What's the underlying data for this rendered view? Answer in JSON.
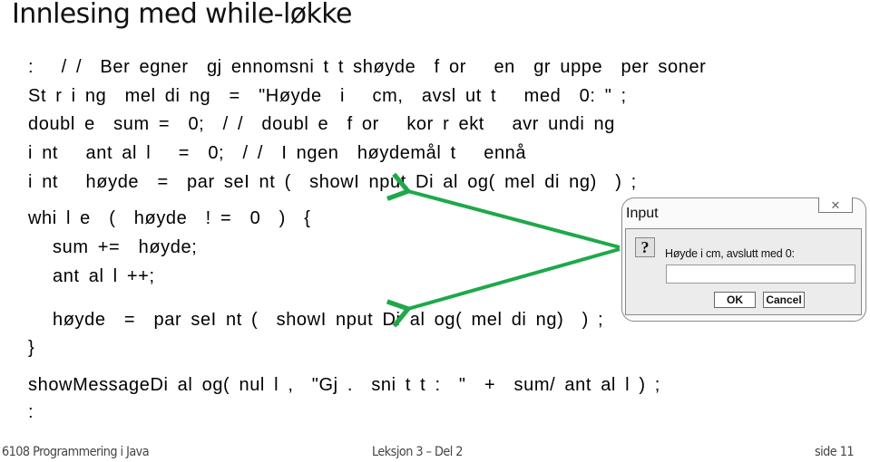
{
  "slide": {
    "title": "Innlesing med while-løkke"
  },
  "code": {
    "lines": [
      ":   / /  Ber egner  gj ennomsni t t shøyde  f or   en  gr uppe  per soner",
      "St r i ng  mel di ng  =  \"Høyde  i   cm,  avsl ut t   med  0: \" ;",
      "doubl e  sum =  0;  / /  doubl e  f or   kor r ekt   avr undi ng",
      "i nt   ant al l   =  0;  / /  I ngen  høydemål t   ennå",
      "i nt   høyde  =  par seI nt (  showI nput Di al og( mel di ng)  ) ;",
      "whi l e  (  høyde  ! =  0  )  {",
      "sum +=  høyde;",
      "ant al l ++;",
      "høyde  =  par seI nt (  showI nput Di al og( mel di ng)  ) ;",
      "}",
      "showMessageDi al og( nul l ,  \"Gj .  sni t t :  \"  +  sum/ ant al l ) ;",
      ":"
    ]
  },
  "arrows": {
    "color": "#1fa84a",
    "from": "input-dialog",
    "to": [
      "showInputDialog-line-1",
      "showInputDialog-line-2"
    ]
  },
  "dialog": {
    "title": "Input",
    "close_icon": "close-icon",
    "question_icon_glyph": "?",
    "message": "Høyde i cm, avslutt med 0:",
    "input_value": "",
    "ok_label": "OK",
    "cancel_label": "Cancel"
  },
  "footer": {
    "course": "6108 Programmering i Java",
    "lesson": "Leksjon 3 – Del 2",
    "page": "side 11"
  }
}
